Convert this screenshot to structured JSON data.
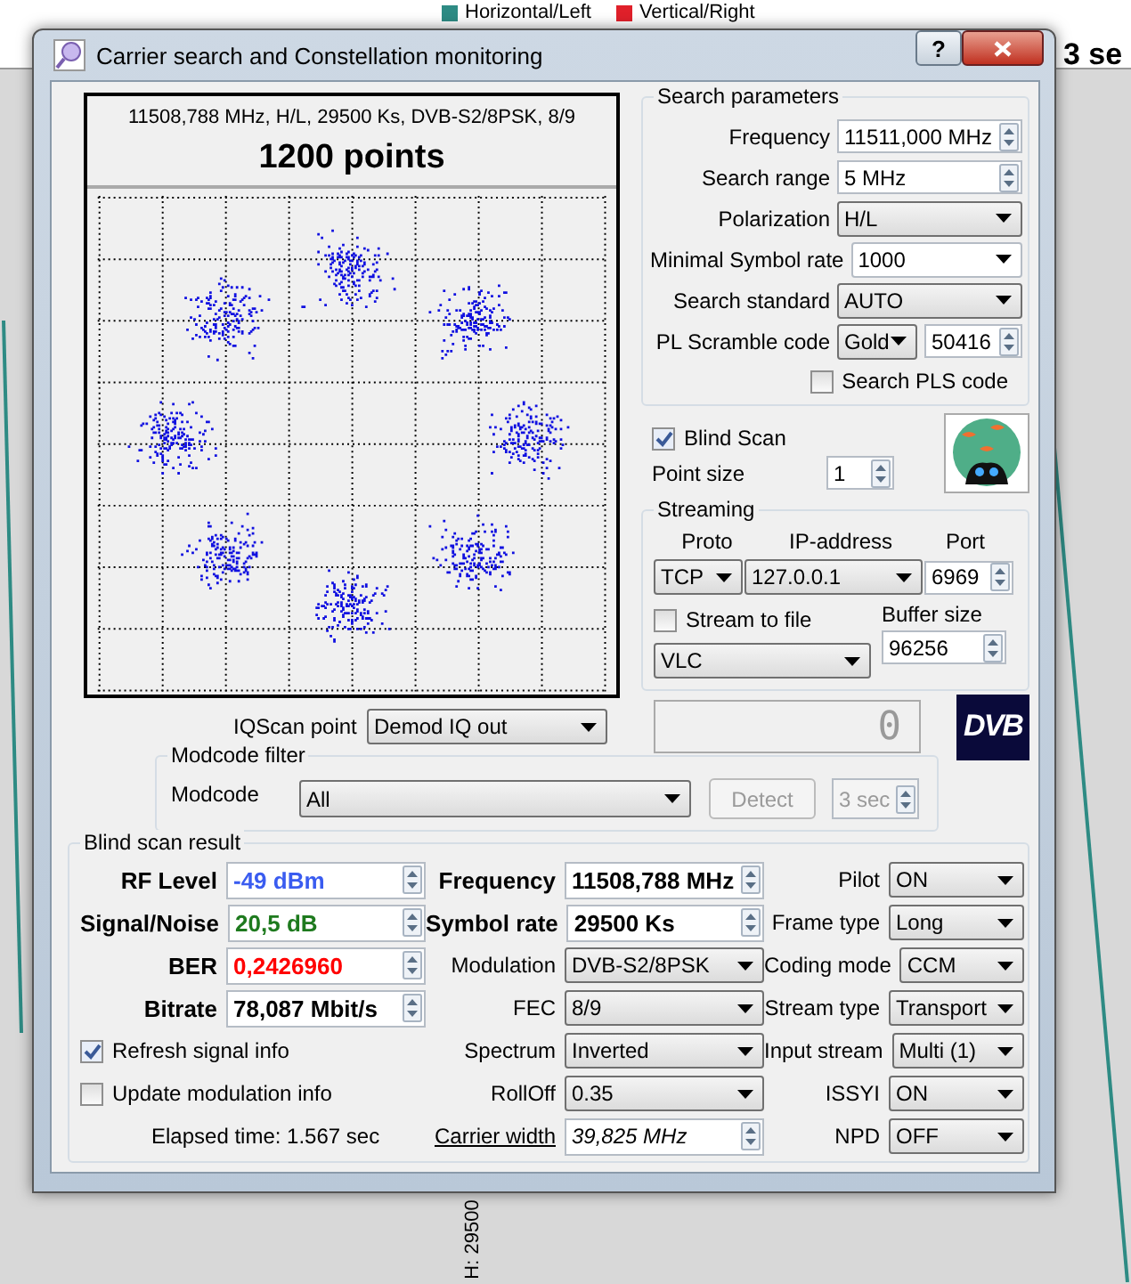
{
  "background": {
    "legend": [
      {
        "label": "Horizontal/Left",
        "color": "#2e8b84"
      },
      {
        "label": "Vertical/Right",
        "color": "#e0202a"
      }
    ],
    "title_fragment": "3 se",
    "axis_label": "H: 29500"
  },
  "window": {
    "title": "Carrier search and Constellation monitoring",
    "help": "?"
  },
  "constellation": {
    "caption": "11508,788 MHz, H/L, 29500 Ks, DVB-S2/8PSK, 8/9",
    "points": "1200 points"
  },
  "search_parameters": {
    "title": "Search parameters",
    "fields": [
      {
        "label": "Frequency",
        "value": "11511,000 MHz",
        "kind": "spin"
      },
      {
        "label": "Search range",
        "value": "5 MHz",
        "kind": "spin"
      },
      {
        "label": "Polarization",
        "value": "H/L",
        "kind": "combo"
      },
      {
        "label": "Minimal Symbol rate",
        "value": "1000",
        "kind": "editcombo"
      },
      {
        "label": "Search standard",
        "value": "AUTO",
        "kind": "combo"
      }
    ],
    "scramble": {
      "label": "PL Scramble code",
      "mode": "Gold",
      "code": "50416"
    },
    "search_pls": {
      "label": "Search PLS code",
      "checked": false
    }
  },
  "blind_scan": {
    "label": "Blind Scan",
    "checked": true
  },
  "point_size": {
    "label": "Point size",
    "value": "1"
  },
  "streaming": {
    "title": "Streaming",
    "proto_label": "Proto",
    "ip_label": "IP-address",
    "port_label": "Port",
    "proto": "TCP",
    "ip": "127.0.0.1",
    "port": "6969",
    "stream_to_file": {
      "label": "Stream to file",
      "checked": false
    },
    "buffer_label": "Buffer size",
    "buffer": "96256",
    "player": "VLC"
  },
  "iqscan": {
    "label": "IQScan point",
    "value": "Demod IQ out"
  },
  "counter": "0",
  "logo": "DVB",
  "modcode_filter": {
    "title": "Modcode filter",
    "label": "Modcode",
    "value": "All",
    "detect": {
      "label": "Detect",
      "disabled": true
    },
    "timeout": {
      "value": "3 sec",
      "disabled": true
    }
  },
  "blind_scan_result": {
    "title": "Blind scan result",
    "readings": [
      {
        "label": "RF Level",
        "value": "-49 dBm",
        "color": "#3a5cf0"
      },
      {
        "label": "Signal/Noise",
        "value": "20,5 dB",
        "color": "#1e7a1e"
      },
      {
        "label": "BER",
        "value": "0,2426960",
        "color": "#ff0000"
      },
      {
        "label": "Bitrate",
        "value": "78,087 Mbit/s",
        "color": "#000000"
      }
    ],
    "options": [
      {
        "label": "Refresh signal info",
        "checked": true
      },
      {
        "label": "Update modulation info",
        "checked": false
      }
    ],
    "elapsed": "Elapsed time: 1.567 sec",
    "details": [
      {
        "label": "Frequency",
        "value": "11508,788 MHz",
        "kind": "reading"
      },
      {
        "label": "Symbol rate",
        "value": "29500 Ks",
        "kind": "reading"
      },
      {
        "label": "Modulation",
        "value": "DVB-S2/8PSK",
        "kind": "combo"
      },
      {
        "label": "FEC",
        "value": "8/9",
        "kind": "combo"
      },
      {
        "label": "Spectrum",
        "value": "Inverted",
        "kind": "combo"
      },
      {
        "label": "RollOff",
        "value": "0.35",
        "kind": "combo"
      },
      {
        "label": "Carrier width",
        "value": "39,825 MHz",
        "kind": "measure"
      }
    ],
    "stream_info": [
      {
        "label": "Pilot",
        "value": "ON"
      },
      {
        "label": "Frame type",
        "value": "Long"
      },
      {
        "label": "Coding mode",
        "value": "CCM"
      },
      {
        "label": "Stream type",
        "value": "Transport"
      },
      {
        "label": "Input stream",
        "value": "Multi (1)"
      },
      {
        "label": "ISSYI",
        "value": "ON"
      },
      {
        "label": "NPD",
        "value": "OFF"
      }
    ]
  }
}
